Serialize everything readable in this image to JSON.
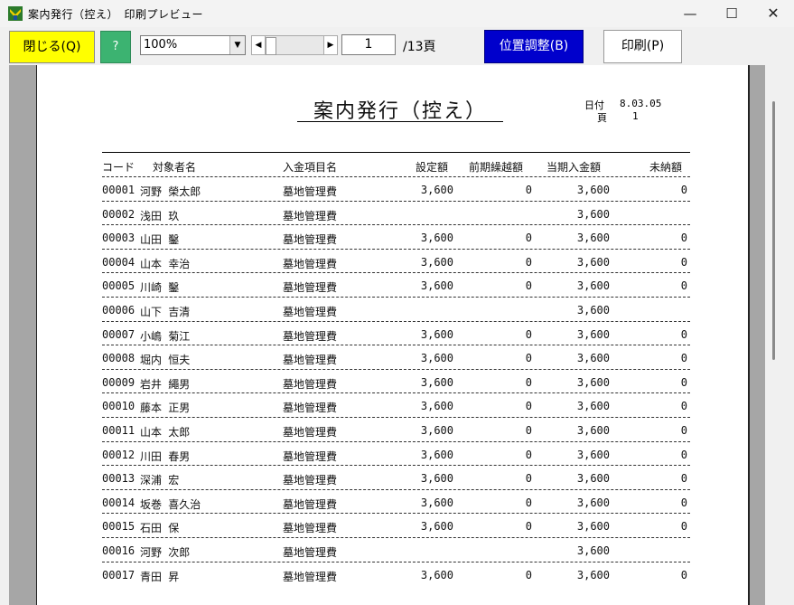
{
  "window": {
    "title": "案内発行（控え）　印刷プレビュー",
    "minimize": "—",
    "maximize": "☐",
    "close": "✕"
  },
  "toolbar": {
    "close_label": "閉じる(Q)",
    "help_label": "?",
    "zoom": "100%",
    "page_current": "1",
    "page_total": "/13頁",
    "adjust_label": "位置調整(B)",
    "print_label": "印刷(P)"
  },
  "report": {
    "title": "案内発行（控え）",
    "date_label": "日付",
    "date_value": "8.03.05",
    "page_label": "頁",
    "page_value": "1",
    "headers": {
      "code": "コード",
      "name": "対象者名",
      "item": "入金項目名",
      "setting": "設定額",
      "carryover": "前期繰越額",
      "current": "当期入金額",
      "unpaid": "未納額"
    },
    "rows": [
      {
        "code": "00001",
        "name": "河野 榮太郎",
        "item": "墓地管理費",
        "set": "3,600",
        "prev": "0",
        "cur": "3,600",
        "unp": "0"
      },
      {
        "code": "00002",
        "name": "浅田 玖",
        "item": "墓地管理費",
        "set": "",
        "prev": "",
        "cur": "3,600",
        "unp": ""
      },
      {
        "code": "00003",
        "name": "山田 鑿",
        "item": "墓地管理費",
        "set": "3,600",
        "prev": "0",
        "cur": "3,600",
        "unp": "0"
      },
      {
        "code": "00004",
        "name": "山本 幸治",
        "item": "墓地管理費",
        "set": "3,600",
        "prev": "0",
        "cur": "3,600",
        "unp": "0"
      },
      {
        "code": "00005",
        "name": "川崎 鑿",
        "item": "墓地管理費",
        "set": "3,600",
        "prev": "0",
        "cur": "3,600",
        "unp": "0"
      },
      {
        "code": "00006",
        "name": "山下 吉清",
        "item": "墓地管理費",
        "set": "",
        "prev": "",
        "cur": "3,600",
        "unp": ""
      },
      {
        "code": "00007",
        "name": "小嶋 菊江",
        "item": "墓地管理費",
        "set": "3,600",
        "prev": "0",
        "cur": "3,600",
        "unp": "0"
      },
      {
        "code": "00008",
        "name": "堀内 恒夫",
        "item": "墓地管理費",
        "set": "3,600",
        "prev": "0",
        "cur": "3,600",
        "unp": "0"
      },
      {
        "code": "00009",
        "name": "岩井 繩男",
        "item": "墓地管理費",
        "set": "3,600",
        "prev": "0",
        "cur": "3,600",
        "unp": "0"
      },
      {
        "code": "00010",
        "name": "藤本 正男",
        "item": "墓地管理費",
        "set": "3,600",
        "prev": "0",
        "cur": "3,600",
        "unp": "0"
      },
      {
        "code": "00011",
        "name": "山本 太郎",
        "item": "墓地管理費",
        "set": "3,600",
        "prev": "0",
        "cur": "3,600",
        "unp": "0"
      },
      {
        "code": "00012",
        "name": "川田 春男",
        "item": "墓地管理費",
        "set": "3,600",
        "prev": "0",
        "cur": "3,600",
        "unp": "0"
      },
      {
        "code": "00013",
        "name": "深浦 宏",
        "item": "墓地管理費",
        "set": "3,600",
        "prev": "0",
        "cur": "3,600",
        "unp": "0"
      },
      {
        "code": "00014",
        "name": "坂巻 喜久治",
        "item": "墓地管理費",
        "set": "3,600",
        "prev": "0",
        "cur": "3,600",
        "unp": "0"
      },
      {
        "code": "00015",
        "name": "石田 保",
        "item": "墓地管理費",
        "set": "3,600",
        "prev": "0",
        "cur": "3,600",
        "unp": "0"
      },
      {
        "code": "00016",
        "name": "河野 次郎",
        "item": "墓地管理費",
        "set": "",
        "prev": "",
        "cur": "3,600",
        "unp": ""
      },
      {
        "code": "00017",
        "name": "青田 昇",
        "item": "墓地管理費",
        "set": "3,600",
        "prev": "0",
        "cur": "3,600",
        "unp": "0"
      }
    ]
  },
  "colors": {
    "close_button": "#ffff00",
    "help_button": "#3cb371",
    "adjust_button": "#0000cc"
  },
  "icons": {
    "app": "app-icon",
    "zoom_dropdown": "chevron-down-icon",
    "scroll_left": "arrow-left-icon",
    "scroll_right": "arrow-right-icon"
  }
}
